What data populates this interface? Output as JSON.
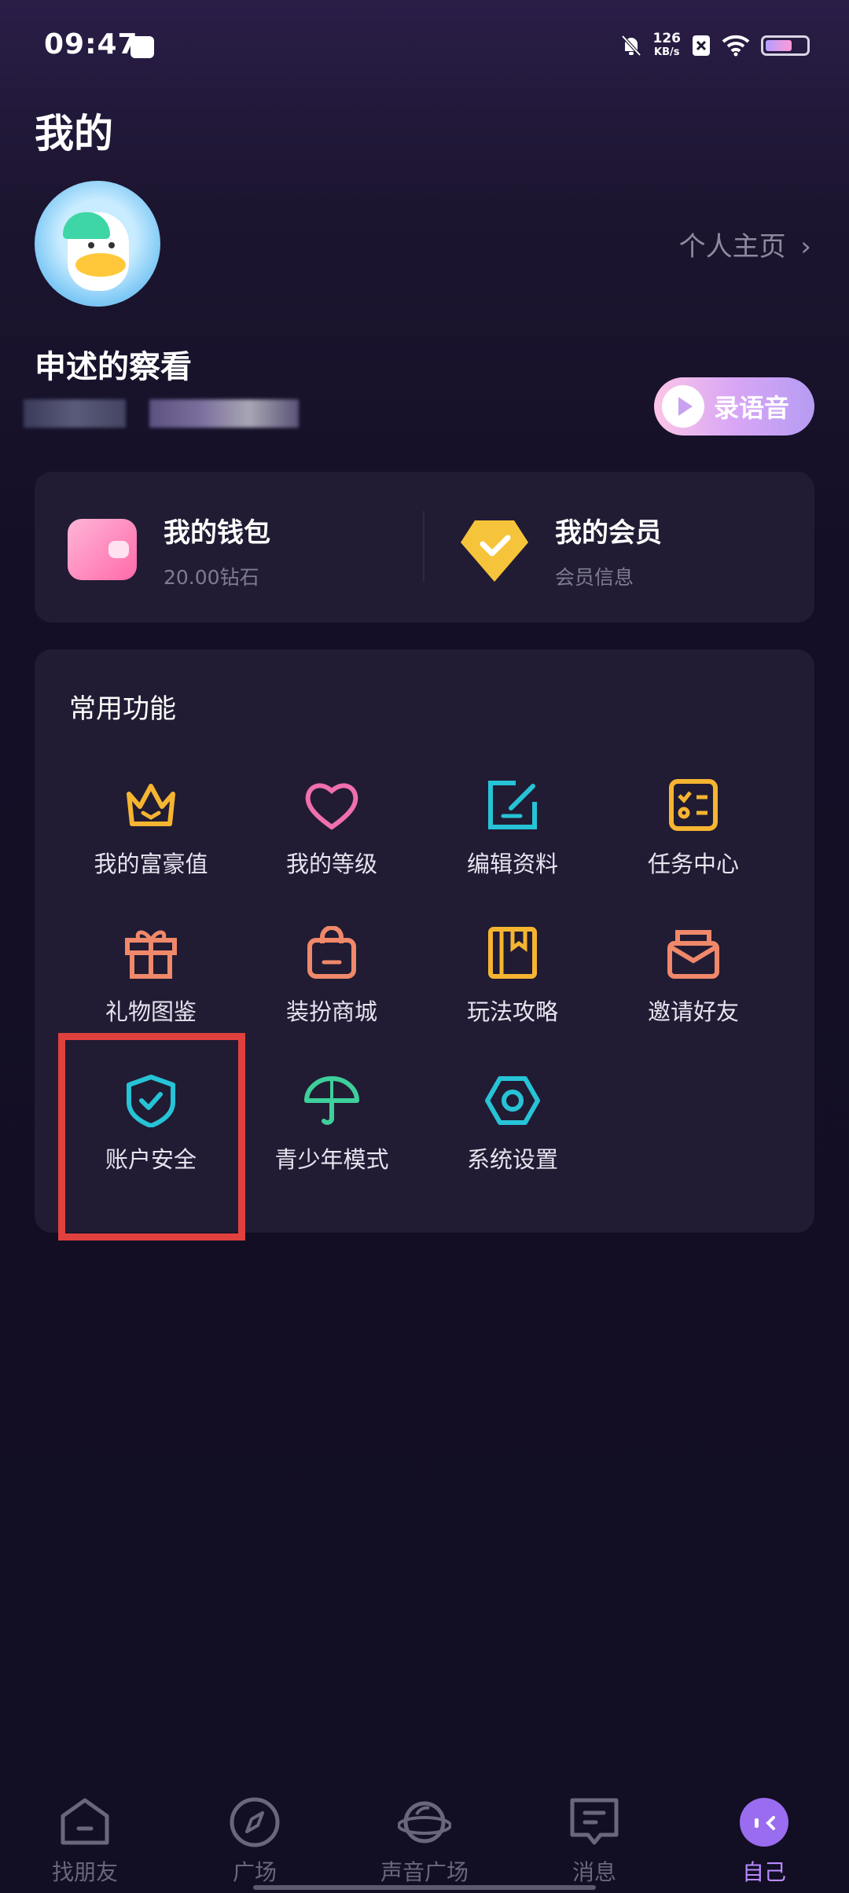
{
  "status_bar": {
    "time": "09:47",
    "net_speed_value": "126",
    "net_speed_unit": "KB/s",
    "battery_level": 0.65
  },
  "page": {
    "title": "我的"
  },
  "profile": {
    "username": "申述的察看",
    "homepage_link": "个人主页",
    "homepage_arrow": "›",
    "record_button": "录语音"
  },
  "wallet": {
    "title": "我的钱包",
    "balance": "20.00钻石"
  },
  "membership": {
    "title": "我的会员",
    "subtitle": "会员信息"
  },
  "features": {
    "section_title": "常用功能",
    "items": [
      {
        "label": "我的富豪值",
        "icon": "crown-icon",
        "color": "#f5b531"
      },
      {
        "label": "我的等级",
        "icon": "heart-icon",
        "color": "#f06fae"
      },
      {
        "label": "编辑资料",
        "icon": "edit-icon",
        "color": "#27c3d6"
      },
      {
        "label": "任务中心",
        "icon": "checklist-icon",
        "color": "#f5b531"
      },
      {
        "label": "礼物图鉴",
        "icon": "gift-icon",
        "color": "#f0886a"
      },
      {
        "label": "装扮商城",
        "icon": "shopping-bag-icon",
        "color": "#f0886a"
      },
      {
        "label": "玩法攻略",
        "icon": "book-icon",
        "color": "#f5b531"
      },
      {
        "label": "邀请好友",
        "icon": "mail-icon",
        "color": "#f0886a"
      },
      {
        "label": "账户安全",
        "icon": "shield-icon",
        "color": "#27c3d6"
      },
      {
        "label": "青少年模式",
        "icon": "umbrella-icon",
        "color": "#3ecf9a"
      },
      {
        "label": "系统设置",
        "icon": "settings-hexagon-icon",
        "color": "#27c3d6"
      }
    ]
  },
  "bottom_nav": [
    {
      "label": "找朋友",
      "icon": "home-icon",
      "active": false
    },
    {
      "label": "广场",
      "icon": "compass-icon",
      "active": false
    },
    {
      "label": "声音广场",
      "icon": "planet-icon",
      "active": false
    },
    {
      "label": "消息",
      "icon": "message-icon",
      "active": false
    },
    {
      "label": "自己",
      "icon": "profile-face-icon",
      "active": true
    }
  ],
  "colors": {
    "accent": "#b88bff",
    "highlight_box": "#e0413e"
  }
}
